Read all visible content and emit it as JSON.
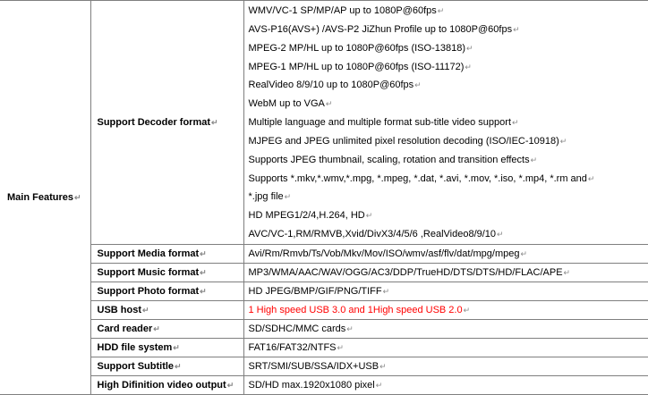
{
  "colors": {
    "grid_line": "#7f7f7f",
    "highlight_text": "#ff0000",
    "paragraph_mark": "#888888"
  },
  "paragraph_mark_glyph": "↵",
  "table": {
    "main_label": "Main Features",
    "decoder": {
      "label": "Support Decoder format",
      "lines": [
        "WMV/VC-1 SP/MP/AP up to 1080P@60fps",
        "AVS-P16(AVS+) /AVS-P2 JiZhun Profile up to 1080P@60fps",
        "MPEG-2 MP/HL up to 1080P@60fps (ISO-13818)",
        "MPEG-1 MP/HL up to 1080P@60fps (ISO-11172)",
        "RealVideo 8/9/10 up to 1080P@60fps",
        "WebM up to VGA",
        "Multiple language and multiple format sub-title video support",
        "MJPEG and JPEG unlimited pixel resolution decoding (ISO/IEC-10918)",
        "Supports JPEG thumbnail, scaling, rotation and transition effects",
        "Supports *.mkv,*.wmv,*.mpg, *.mpeg, *.dat, *.avi, *.mov, *.iso, *.mp4, *.rm and",
        "*.jpg file",
        "HD MPEG1/2/4,H.264, HD",
        "AVC/VC-1,RM/RMVB,Xvid/DivX3/4/5/6 ,RealVideo8/9/10"
      ]
    },
    "rows": [
      {
        "label": "Support Media format",
        "value": "Avi/Rm/Rmvb/Ts/Vob/Mkv/Mov/ISO/wmv/asf/flv/dat/mpg/mpeg"
      },
      {
        "label": "Support Music format",
        "value": "MP3/WMA/AAC/WAV/OGG/AC3/DDP/TrueHD/DTS/DTS/HD/FLAC/APE"
      },
      {
        "label": "Support Photo format",
        "value": "HD JPEG/BMP/GIF/PNG/TIFF"
      },
      {
        "label": "USB host",
        "value": "1 High speed USB 3.0 and 1High speed USB 2.0",
        "highlight": true
      },
      {
        "label": "Card reader",
        "value": "SD/SDHC/MMC cards"
      },
      {
        "label": "HDD file system",
        "value": "FAT16/FAT32/NTFS"
      },
      {
        "label": "Support Subtitle",
        "value": "SRT/SMI/SUB/SSA/IDX+USB"
      },
      {
        "label": "High Difinition video output",
        "value": "SD/HD max.1920x1080 pixel"
      }
    ]
  }
}
